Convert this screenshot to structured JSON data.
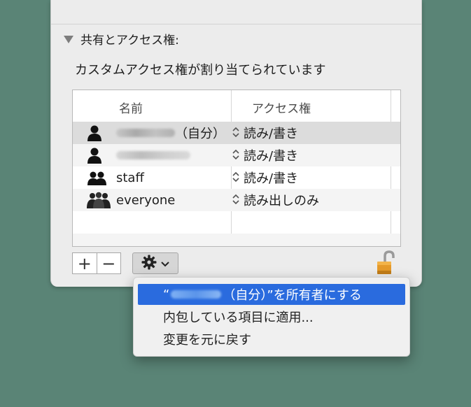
{
  "section": {
    "title": "共有とアクセス権:"
  },
  "status": {
    "text": "カスタムアクセス権が割り当てられています"
  },
  "table": {
    "headers": {
      "name": "名前",
      "access": "アクセス権"
    },
    "rows": [
      {
        "name_suffix": "（自分）",
        "access": "読み/書き",
        "icon": "user-icon",
        "selected": true
      },
      {
        "name_suffix": "",
        "access": "読み/書き",
        "icon": "user-icon"
      },
      {
        "name": "staff",
        "access": "読み/書き",
        "icon": "group-icon"
      },
      {
        "name": "everyone",
        "access": "読み出しのみ",
        "icon": "everyone-icon"
      }
    ]
  },
  "buttons": {
    "add": "+",
    "remove": "−",
    "action_chevron": "⌄"
  },
  "menu": {
    "items": [
      {
        "prefix": "“",
        "suffix": "（自分）”を所有者にする",
        "highlighted": true
      },
      {
        "label": "内包している項目に適用..."
      },
      {
        "label": "変更を元に戻す"
      }
    ]
  },
  "colors": {
    "desktop": "#5a8476",
    "highlight": "#2a6bde",
    "panel": "#ececec"
  }
}
